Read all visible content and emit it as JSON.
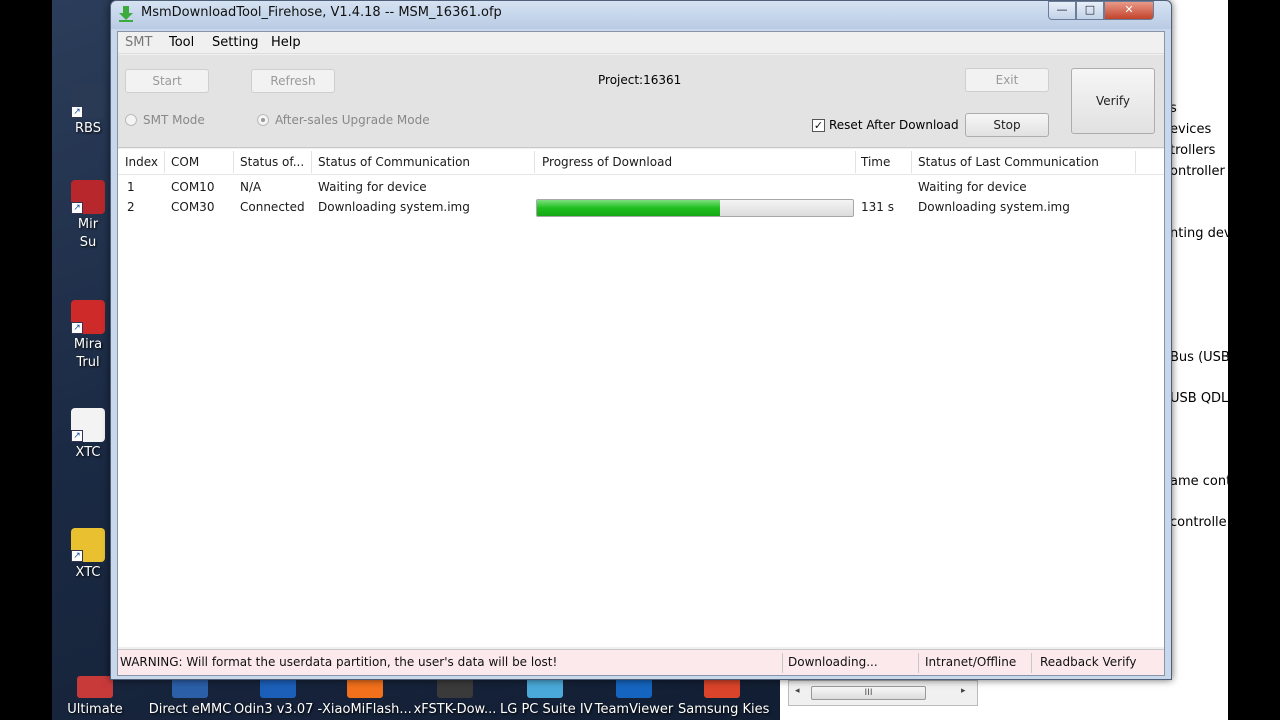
{
  "window": {
    "title": "MsmDownloadTool_Firehose, V1.4.18 -- MSM_16361.ofp",
    "controls": {
      "minimize": "—",
      "maximize": "□",
      "close": "✕"
    }
  },
  "menu": [
    "SMT",
    "Tool",
    "Setting",
    "Help"
  ],
  "toolbar": {
    "start_label": "Start",
    "refresh_label": "Refresh",
    "project_label": "Project:16361",
    "exit_label": "Exit",
    "verify_label": "Verify",
    "stop_label": "Stop",
    "smt_mode_label": "SMT Mode",
    "aftersales_label": "After-sales Upgrade Mode",
    "reset_after_download_label": "Reset After Download",
    "reset_after_download_checked": true,
    "selected_mode": "After-sales Upgrade Mode"
  },
  "table": {
    "headers": [
      "Index",
      "COM",
      "Status of...",
      "Status of Communication",
      "Progress of Download",
      "Time",
      "Status of Last Communication"
    ],
    "rows": [
      {
        "index": "1",
        "com": "COM10",
        "status": "N/A",
        "communication": "Waiting for device",
        "progress": 0,
        "time": "",
        "last": "Waiting for device"
      },
      {
        "index": "2",
        "com": "COM30",
        "status": "Connected",
        "communication": "Downloading system.img",
        "progress": 0.58,
        "time": "131 s",
        "last": "Downloading system.img"
      }
    ]
  },
  "statusbar": {
    "warning": "WARNING: Will format the userdata partition, the user's data will be lost!",
    "state": "Downloading...",
    "network": "Intranet/Offline",
    "readback": "Readback Verify"
  },
  "desktop": {
    "left_icons": [
      "RBS",
      "Mir\nSu",
      "Mira\nTrul",
      "XTC",
      "XTC"
    ],
    "taskbar_icons": [
      "Ultimate",
      "Direct eMMC",
      "Odin3 v3.07 -",
      "XiaoMiFlash...",
      "xFSTK-Dow...",
      "LG PC Suite IV",
      "TeamViewer",
      "Samsung Kies"
    ],
    "right_panel_lines": [
      "s",
      "evices",
      "trollers",
      "ontroller",
      "nting devi",
      "Bus (USB)",
      "USB QDLo",
      "ame cont",
      "controlle"
    ],
    "scrollbar_thumb": "III"
  },
  "colors": {
    "progress_fill": "#1fbf1f",
    "statusbar_bg": "#fce9ec",
    "titlebar": "#c9d7ea"
  }
}
